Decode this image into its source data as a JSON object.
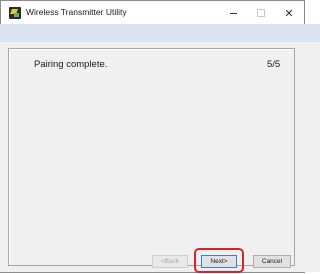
{
  "window": {
    "title": "Wireless Transmitter Utility",
    "icon": "app-icon"
  },
  "controls": {
    "minimize_symbol": "",
    "maximize_symbol": "",
    "close_symbol": "✕"
  },
  "wizard": {
    "heading": "Pairing complete.",
    "step": "5/5"
  },
  "buttons": {
    "back": "<Back",
    "next": "Next>",
    "cancel": "Cancel"
  },
  "colors": {
    "highlight": "#d8232a",
    "header_band": "#dbe2f1",
    "focus_border": "#3c7fd1"
  }
}
